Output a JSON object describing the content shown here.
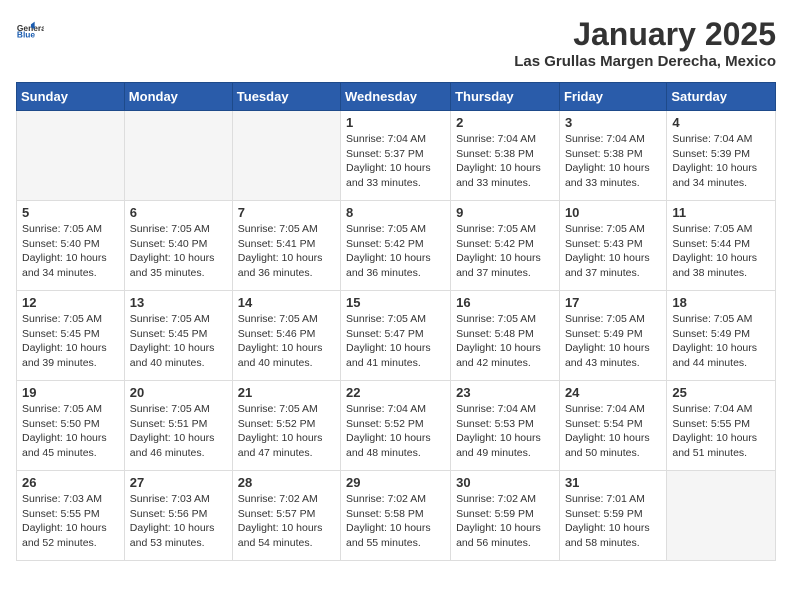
{
  "header": {
    "logo_general": "General",
    "logo_blue": "Blue",
    "month_title": "January 2025",
    "location": "Las Grullas Margen Derecha, Mexico"
  },
  "days_of_week": [
    "Sunday",
    "Monday",
    "Tuesday",
    "Wednesday",
    "Thursday",
    "Friday",
    "Saturday"
  ],
  "weeks": [
    [
      {
        "day": "",
        "info": ""
      },
      {
        "day": "",
        "info": ""
      },
      {
        "day": "",
        "info": ""
      },
      {
        "day": "1",
        "info": "Sunrise: 7:04 AM\nSunset: 5:37 PM\nDaylight: 10 hours\nand 33 minutes."
      },
      {
        "day": "2",
        "info": "Sunrise: 7:04 AM\nSunset: 5:38 PM\nDaylight: 10 hours\nand 33 minutes."
      },
      {
        "day": "3",
        "info": "Sunrise: 7:04 AM\nSunset: 5:38 PM\nDaylight: 10 hours\nand 33 minutes."
      },
      {
        "day": "4",
        "info": "Sunrise: 7:04 AM\nSunset: 5:39 PM\nDaylight: 10 hours\nand 34 minutes."
      }
    ],
    [
      {
        "day": "5",
        "info": "Sunrise: 7:05 AM\nSunset: 5:40 PM\nDaylight: 10 hours\nand 34 minutes."
      },
      {
        "day": "6",
        "info": "Sunrise: 7:05 AM\nSunset: 5:40 PM\nDaylight: 10 hours\nand 35 minutes."
      },
      {
        "day": "7",
        "info": "Sunrise: 7:05 AM\nSunset: 5:41 PM\nDaylight: 10 hours\nand 36 minutes."
      },
      {
        "day": "8",
        "info": "Sunrise: 7:05 AM\nSunset: 5:42 PM\nDaylight: 10 hours\nand 36 minutes."
      },
      {
        "day": "9",
        "info": "Sunrise: 7:05 AM\nSunset: 5:42 PM\nDaylight: 10 hours\nand 37 minutes."
      },
      {
        "day": "10",
        "info": "Sunrise: 7:05 AM\nSunset: 5:43 PM\nDaylight: 10 hours\nand 37 minutes."
      },
      {
        "day": "11",
        "info": "Sunrise: 7:05 AM\nSunset: 5:44 PM\nDaylight: 10 hours\nand 38 minutes."
      }
    ],
    [
      {
        "day": "12",
        "info": "Sunrise: 7:05 AM\nSunset: 5:45 PM\nDaylight: 10 hours\nand 39 minutes."
      },
      {
        "day": "13",
        "info": "Sunrise: 7:05 AM\nSunset: 5:45 PM\nDaylight: 10 hours\nand 40 minutes."
      },
      {
        "day": "14",
        "info": "Sunrise: 7:05 AM\nSunset: 5:46 PM\nDaylight: 10 hours\nand 40 minutes."
      },
      {
        "day": "15",
        "info": "Sunrise: 7:05 AM\nSunset: 5:47 PM\nDaylight: 10 hours\nand 41 minutes."
      },
      {
        "day": "16",
        "info": "Sunrise: 7:05 AM\nSunset: 5:48 PM\nDaylight: 10 hours\nand 42 minutes."
      },
      {
        "day": "17",
        "info": "Sunrise: 7:05 AM\nSunset: 5:49 PM\nDaylight: 10 hours\nand 43 minutes."
      },
      {
        "day": "18",
        "info": "Sunrise: 7:05 AM\nSunset: 5:49 PM\nDaylight: 10 hours\nand 44 minutes."
      }
    ],
    [
      {
        "day": "19",
        "info": "Sunrise: 7:05 AM\nSunset: 5:50 PM\nDaylight: 10 hours\nand 45 minutes."
      },
      {
        "day": "20",
        "info": "Sunrise: 7:05 AM\nSunset: 5:51 PM\nDaylight: 10 hours\nand 46 minutes."
      },
      {
        "day": "21",
        "info": "Sunrise: 7:05 AM\nSunset: 5:52 PM\nDaylight: 10 hours\nand 47 minutes."
      },
      {
        "day": "22",
        "info": "Sunrise: 7:04 AM\nSunset: 5:52 PM\nDaylight: 10 hours\nand 48 minutes."
      },
      {
        "day": "23",
        "info": "Sunrise: 7:04 AM\nSunset: 5:53 PM\nDaylight: 10 hours\nand 49 minutes."
      },
      {
        "day": "24",
        "info": "Sunrise: 7:04 AM\nSunset: 5:54 PM\nDaylight: 10 hours\nand 50 minutes."
      },
      {
        "day": "25",
        "info": "Sunrise: 7:04 AM\nSunset: 5:55 PM\nDaylight: 10 hours\nand 51 minutes."
      }
    ],
    [
      {
        "day": "26",
        "info": "Sunrise: 7:03 AM\nSunset: 5:55 PM\nDaylight: 10 hours\nand 52 minutes."
      },
      {
        "day": "27",
        "info": "Sunrise: 7:03 AM\nSunset: 5:56 PM\nDaylight: 10 hours\nand 53 minutes."
      },
      {
        "day": "28",
        "info": "Sunrise: 7:02 AM\nSunset: 5:57 PM\nDaylight: 10 hours\nand 54 minutes."
      },
      {
        "day": "29",
        "info": "Sunrise: 7:02 AM\nSunset: 5:58 PM\nDaylight: 10 hours\nand 55 minutes."
      },
      {
        "day": "30",
        "info": "Sunrise: 7:02 AM\nSunset: 5:59 PM\nDaylight: 10 hours\nand 56 minutes."
      },
      {
        "day": "31",
        "info": "Sunrise: 7:01 AM\nSunset: 5:59 PM\nDaylight: 10 hours\nand 58 minutes."
      },
      {
        "day": "",
        "info": ""
      }
    ]
  ]
}
